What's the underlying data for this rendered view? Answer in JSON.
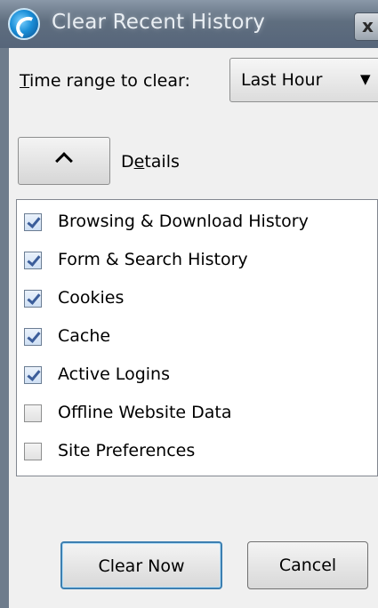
{
  "window": {
    "title": "Clear Recent History",
    "close_glyph": "x",
    "icon": "browser-logo-icon"
  },
  "time_range": {
    "label_accel": "T",
    "label_rest": "ime range to clear:",
    "selected": "Last Hour",
    "arrow": "▼"
  },
  "details": {
    "label_pre": "D",
    "label_accel": "e",
    "label_rest": "tails",
    "expanded": true
  },
  "items": [
    {
      "label": "Browsing & Download History",
      "checked": true
    },
    {
      "label": "Form & Search History",
      "checked": true
    },
    {
      "label": "Cookies",
      "checked": true
    },
    {
      "label": "Cache",
      "checked": true
    },
    {
      "label": "Active Logins",
      "checked": true
    },
    {
      "label": "Offline Website Data",
      "checked": false
    },
    {
      "label": "Site Preferences",
      "checked": false
    }
  ],
  "buttons": {
    "clear_now": "Clear Now",
    "cancel": "Cancel"
  },
  "colors": {
    "titlebar": "#5f6e7f",
    "default_button_border": "#3c7fb1",
    "checkmark": "#3b5d9a"
  }
}
